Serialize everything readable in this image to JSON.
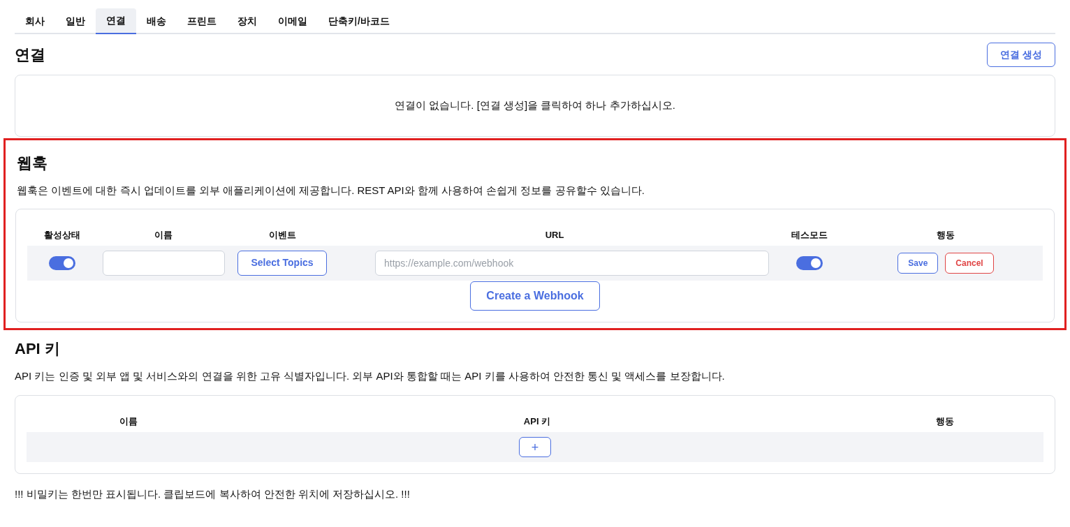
{
  "tabs": [
    {
      "label": "회사",
      "selected": false
    },
    {
      "label": "일반",
      "selected": false
    },
    {
      "label": "연결",
      "selected": true
    },
    {
      "label": "배송",
      "selected": false
    },
    {
      "label": "프린트",
      "selected": false
    },
    {
      "label": "장치",
      "selected": false
    },
    {
      "label": "이메일",
      "selected": false
    },
    {
      "label": "단축키/바코드",
      "selected": false
    }
  ],
  "connections": {
    "title": "연결",
    "create_button": "연결 생성",
    "empty_message": "연결이 없습니다. [연결 생성]을 클릭하여 하나 추가하십시오."
  },
  "webhooks": {
    "highlighted": true,
    "title": "웹훅",
    "description": "웹훅은 이벤트에 대한 즉시 업데이트를 외부 애플리케이션에 제공합니다. REST API와 함께 사용하여 손쉽게 정보를 공유할수 있습니다.",
    "columns": [
      "활성상태",
      "이름",
      "이벤트",
      "URL",
      "테스모드",
      "행동"
    ],
    "rows": [
      {
        "active": true,
        "name": "",
        "events_button": "Select Topics",
        "url_placeholder": "https://example.com/webhook",
        "test_mode": true,
        "save": "Save",
        "cancel": "Cancel"
      }
    ],
    "create_button": "Create a Webhook"
  },
  "api_keys": {
    "title": "API 키",
    "description": "API 키는 인증 및 외부 앱 및 서비스와의 연결을 위한 고유 식별자입니다. 외부 API와 통합할 때는 API 키를 사용하여 안전한 통신 및 액세스를 보장합니다.",
    "columns": [
      "이름",
      "API 키",
      "행동"
    ],
    "add_button": "+"
  },
  "footer_note": "!!! 비밀키는 한번만 표시됩니다. 클립보드에 복사하여 안전한 위치에 저장하십시오. !!!"
}
